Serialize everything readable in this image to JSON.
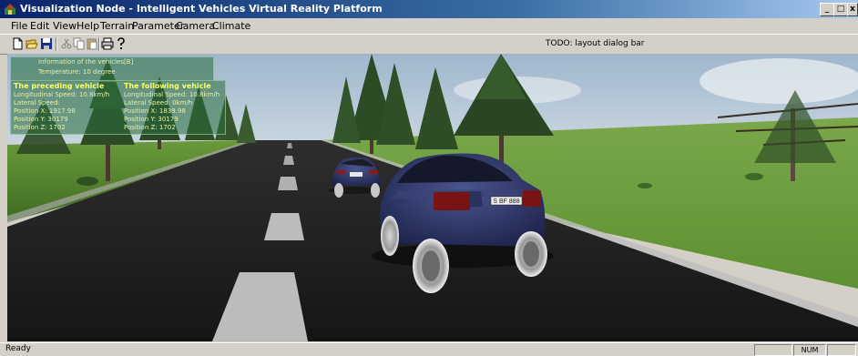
{
  "window": {
    "title": "Visualization Node - Intelligent Vehicles Virtual Reality Platform",
    "minimize_glyph": "_",
    "maximize_glyph": "□",
    "close_glyph": "x"
  },
  "menu": [
    "File",
    "Edit",
    "View",
    "Help",
    "Terrain",
    "Parameter",
    "Camera",
    "Climate"
  ],
  "toolbar": {
    "icons": [
      "new-file-icon",
      "open-folder-icon",
      "save-icon",
      "cut-icon",
      "copy-icon",
      "paste-icon",
      "print-icon",
      "help-icon"
    ],
    "todo_text": "TODO: layout dialog bar"
  },
  "overlay": {
    "info_title": "Information of the vehicles[B]",
    "temperature": "Temperature: 10   degree",
    "preceding": {
      "title": "The preceding vehicle",
      "longitudinal_speed": "Longitudinal Speed: 10.8km/h",
      "lateral_speed": "Lateral Speed:",
      "position_x": "Position  X:  1917.98",
      "position_y": "Position  Y:  30179",
      "position_z": "Position  Z:  1702"
    },
    "following": {
      "title": "The following vehicle",
      "longitudinal_speed": "Longitudinal  Speed: 10.8km/h",
      "lateral_speed": "Lateral  Speed: 0km/h",
      "position_x": "Position  X:  1839.98",
      "position_y": "Position  Y:  30179",
      "position_z": "Position  Z:  1702"
    }
  },
  "car": {
    "plate": "S BF 888",
    "body_color": "#2a3158"
  },
  "colors": {
    "sky_top": "#a9c0d8",
    "sky_bottom": "#d6e0e8",
    "grass": "#5a8a2e",
    "road": "#222222",
    "panel_text": "#e8f0a8",
    "panel_head": "#ffff60"
  },
  "statusbar": {
    "ready": "Ready",
    "num": "NUM"
  }
}
